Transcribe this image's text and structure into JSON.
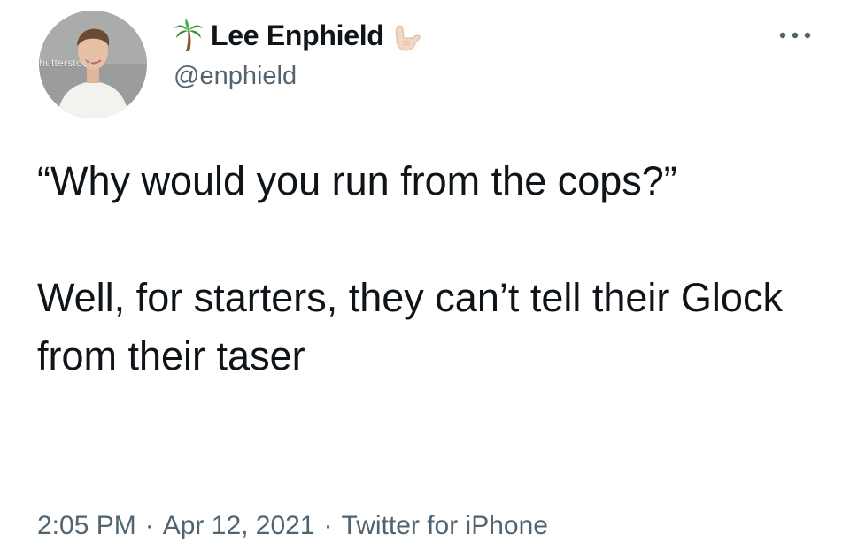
{
  "author": {
    "display_name": "Lee Enphield",
    "handle": "@enphield",
    "name_prefix_icon": "palm-tree-icon",
    "name_suffix_icon": "call-me-hand-icon",
    "avatar_watermark": "shutterstock"
  },
  "tweet": {
    "paragraphs": [
      "“Why would you run from the cops?”",
      "Well, for starters, they can’t tell their Glock from their taser"
    ],
    "time": "2:05 PM",
    "date": "Apr 12, 2021",
    "source": "Twitter for iPhone",
    "separator": "·"
  },
  "menu": {
    "icon": "more-options-icon"
  },
  "colors": {
    "text_primary": "#0f1419",
    "text_secondary": "#536471",
    "background": "#ffffff"
  }
}
